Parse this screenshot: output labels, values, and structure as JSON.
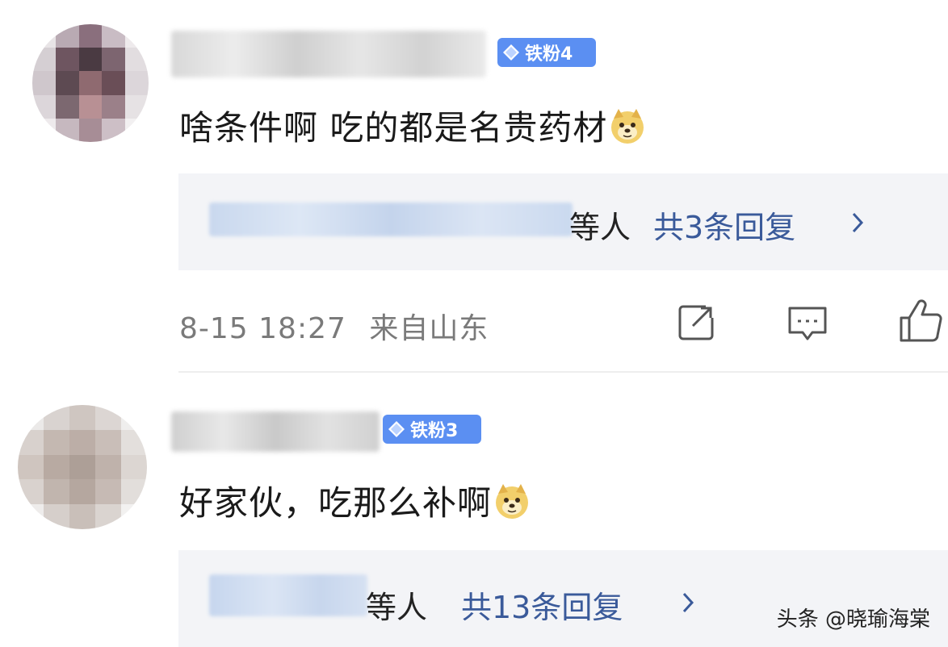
{
  "comments": [
    {
      "badge": "铁粉4",
      "text": "啥条件啊 吃的都是名贵药材",
      "reply_suffix": "等人",
      "reply_count": "共3条回复",
      "time": "8-15 18:27",
      "location": "来自山东"
    },
    {
      "badge": "铁粉3",
      "text": "好家伙，吃那么补啊",
      "reply_suffix": "等人",
      "reply_count": "共13条回复"
    }
  ],
  "watermark": "头条 @晓瑜海棠",
  "colors": {
    "badge": "#5b8ff2",
    "reply_link": "#3a5a9a",
    "reply_bg": "#f3f4f7",
    "meta": "#7a7a7a"
  }
}
